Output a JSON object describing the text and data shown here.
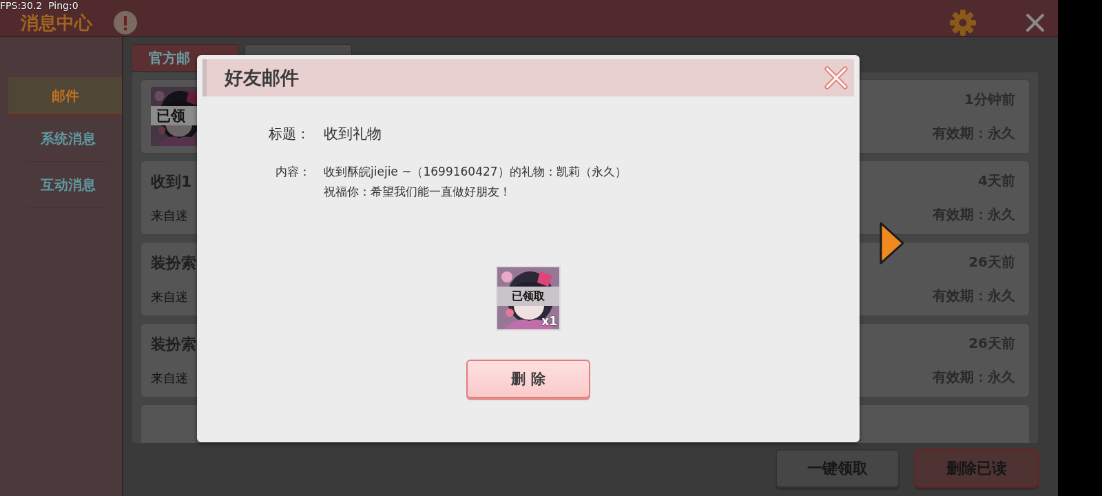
{
  "overlay": {
    "fps_text": "FPS:30.2  Ping:0"
  },
  "header": {
    "title": "消息中心"
  },
  "sidebar": {
    "items": [
      {
        "label": "邮件",
        "selected": true
      },
      {
        "label": "系统消息",
        "selected": false
      },
      {
        "label": "互动消息",
        "selected": false
      }
    ]
  },
  "tabs": [
    {
      "label": "官方邮",
      "selected": true
    },
    {
      "selected": false
    }
  ],
  "mail_list": [
    {
      "kind": "picture",
      "picture_label": "已领",
      "time": "1分钟前",
      "validity": "有效期：永久"
    },
    {
      "kind": "text",
      "title": "收到1",
      "sender": "来自迷",
      "time": "4天前",
      "validity": "有效期：永久"
    },
    {
      "kind": "text",
      "title": "装扮索",
      "sender": "来自迷",
      "time": "26天前",
      "validity": "有效期：永久"
    },
    {
      "kind": "text",
      "title": "装扮索",
      "sender": "来自迷",
      "time": "26天前",
      "validity": "有效期：永久"
    },
    {
      "kind": "empty"
    }
  ],
  "buttons": [
    {
      "label": "一键领取",
      "kind": "plain"
    },
    {
      "label": "删除已读",
      "kind": "danger"
    }
  ],
  "dialog": {
    "title": "好友邮件",
    "subject_label": "标题：",
    "subject": "收到礼物",
    "content_label": "内容：",
    "content_lines": [
      "收到酥皖jiejie ~（1699160427）的礼物：凯莉（永久）",
      "祝福你：希望我们能一直做好朋友！"
    ],
    "item": {
      "status": "已领取",
      "count": "x1"
    },
    "delete_button": "删 除"
  }
}
